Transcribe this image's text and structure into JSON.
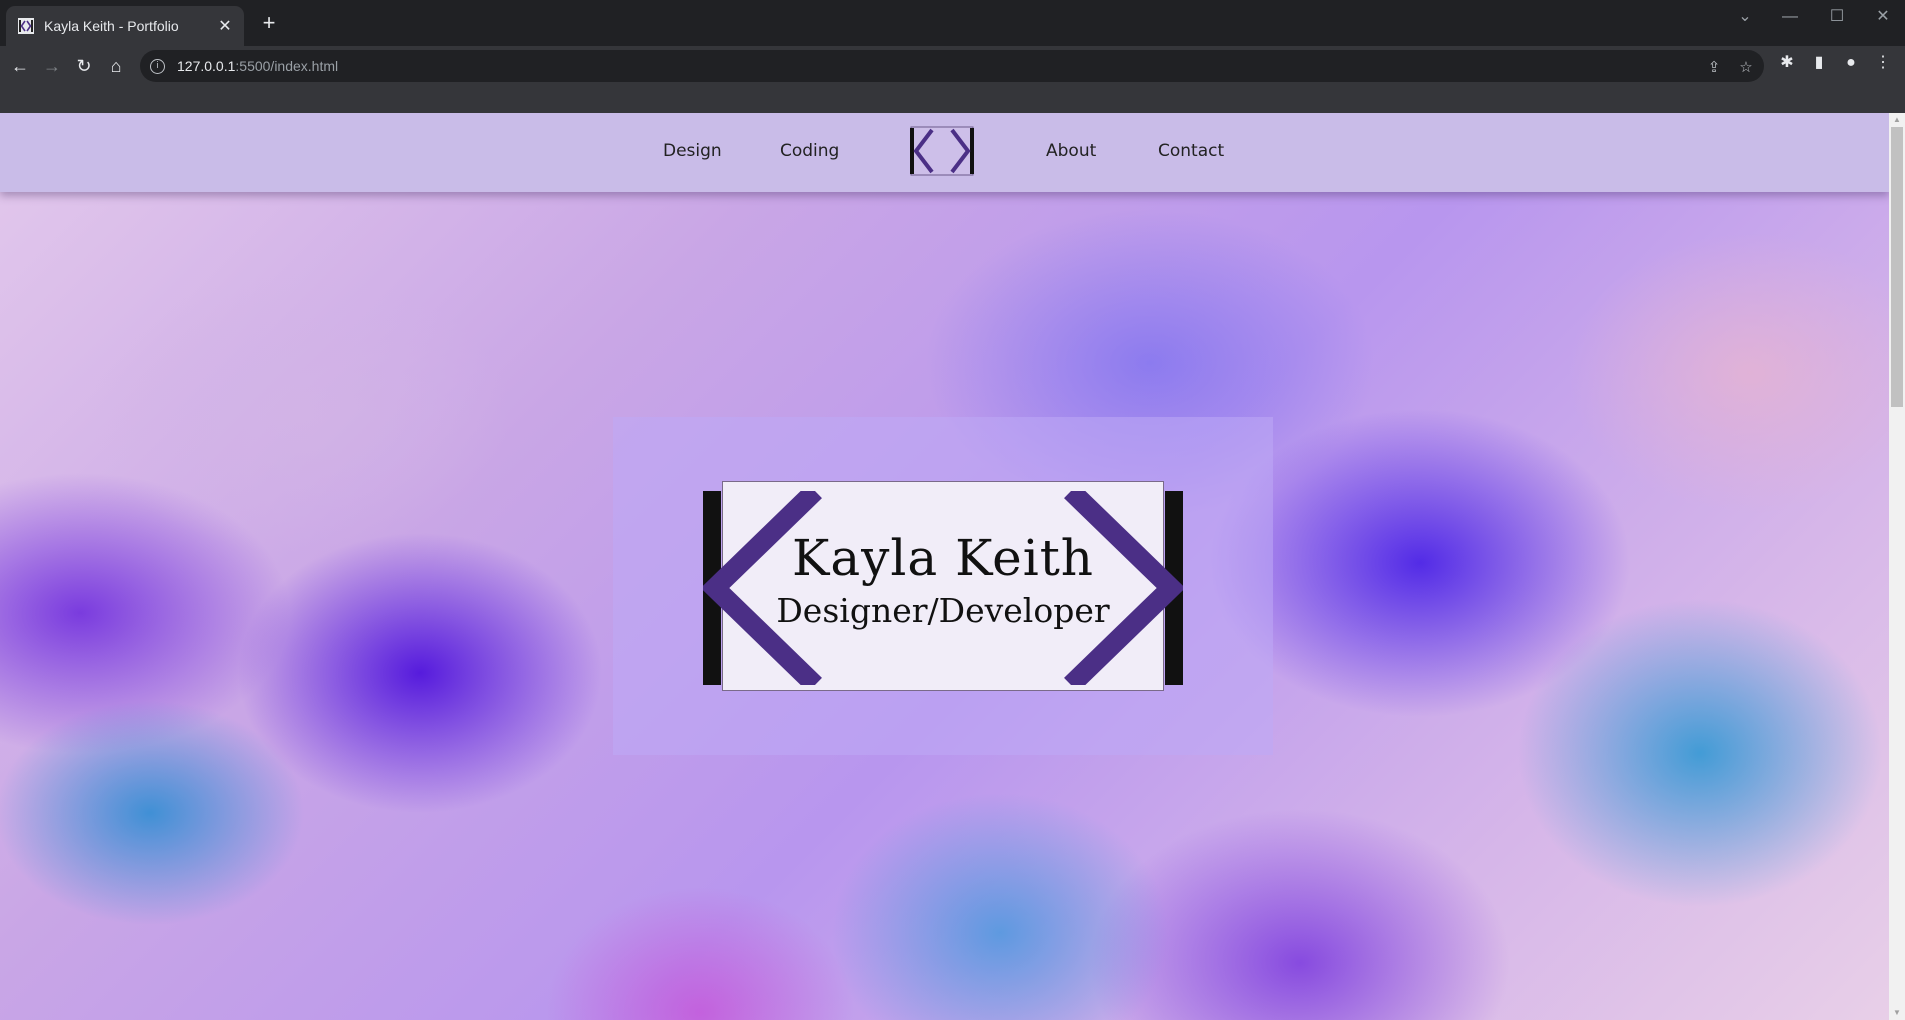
{
  "browser": {
    "tab_title": "Kayla Keith - Portfolio",
    "tab_close": "✕",
    "new_tab": "+",
    "url_host": "127.0.0.1",
    "url_path": ":5500/index.html",
    "controls": {
      "minimize": "—",
      "maximize": "☐",
      "close": "✕",
      "tab_search": "⌄"
    }
  },
  "nav": {
    "links": [
      "Design",
      "Coding",
      "About",
      "Contact"
    ],
    "logo_icon": "kk-logo-icon",
    "background": "#c9bce8"
  },
  "hero": {
    "name": "Kayla Keith",
    "role": "Designer/Developer",
    "accent": "#4b2f86"
  }
}
